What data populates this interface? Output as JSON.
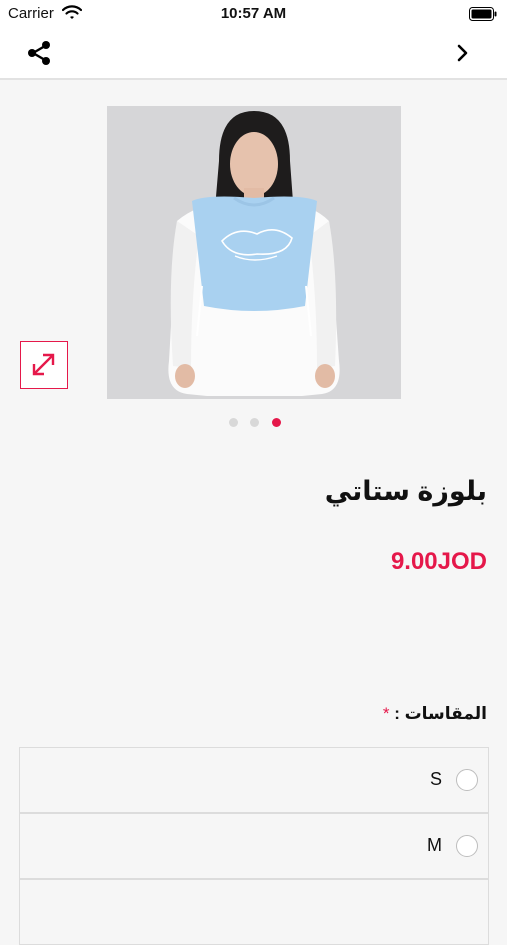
{
  "status_bar": {
    "carrier": "Carrier",
    "time": "10:57 AM"
  },
  "nav": {
    "share_icon": "share-icon",
    "forward_icon": "chevron-right-icon"
  },
  "gallery": {
    "expand_icon": "expand-arrows-icon",
    "page_count": 3,
    "active_index": 2
  },
  "product": {
    "title": "بلوزة ستاتي",
    "price": "9.00JOD"
  },
  "sizes": {
    "label": "المقاسات :",
    "required_mark": "*",
    "options": [
      {
        "label": "S"
      },
      {
        "label": "M"
      }
    ]
  },
  "colors": {
    "accent": "#e5184a",
    "top_blue": "#a9d1f0",
    "background": "#f6f6f6"
  }
}
